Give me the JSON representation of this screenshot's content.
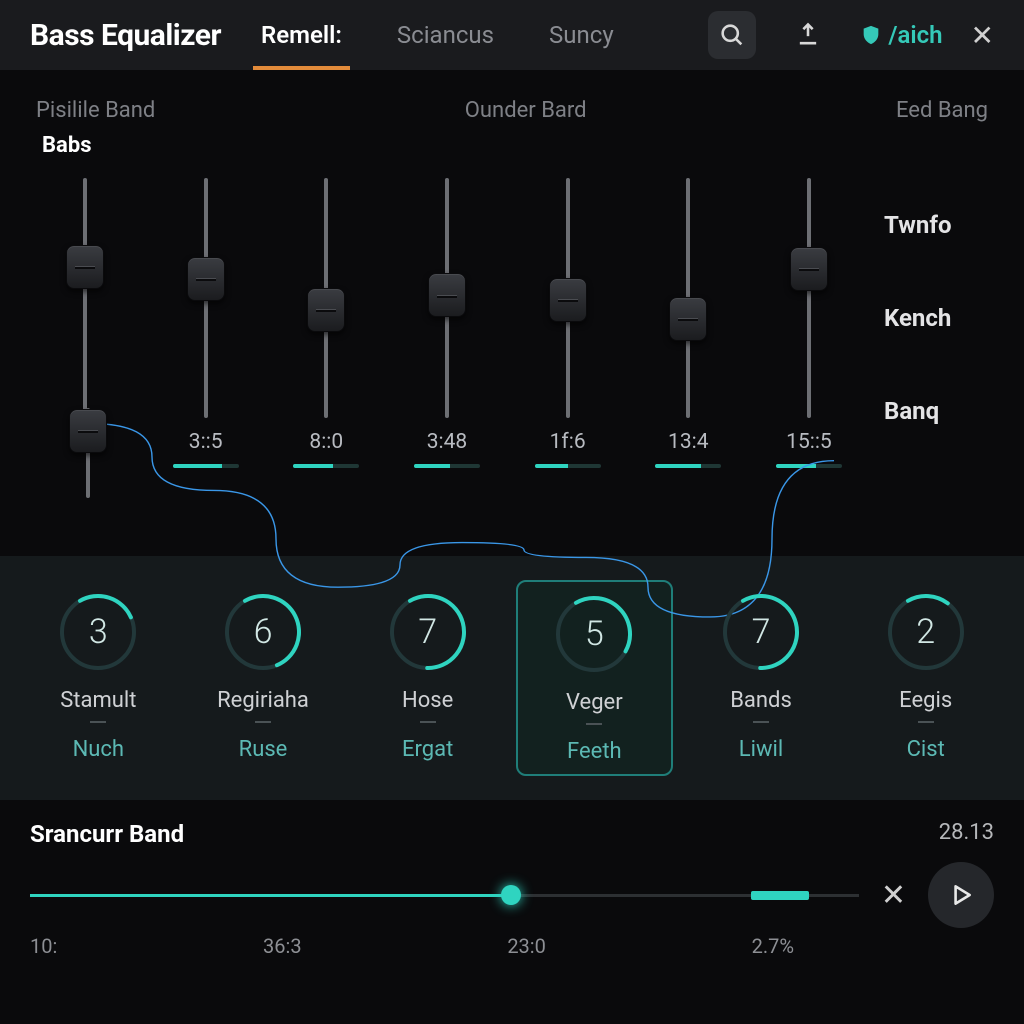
{
  "header": {
    "title": "Bass Equalizer",
    "tabs": [
      {
        "label": "Remell:",
        "active": true
      },
      {
        "label": "Sciancus",
        "active": false
      },
      {
        "label": "Suncy",
        "active": false
      }
    ],
    "aich_label": "/aich"
  },
  "eq": {
    "top_left": "Pisilile Band",
    "top_center": "Ounder Bard",
    "top_right": "Eed Bang",
    "babs": "Babs",
    "sliders": [
      {
        "pos": 33,
        "val_label": "",
        "bar_pct": 0
      },
      {
        "pos": 42,
        "val_label": "3::5",
        "bar_pct": 75
      },
      {
        "pos": 55,
        "val_label": "8::0",
        "bar_pct": 60
      },
      {
        "pos": 49,
        "val_label": "3:48",
        "bar_pct": 55
      },
      {
        "pos": 51,
        "val_label": "1f:6",
        "bar_pct": 50
      },
      {
        "pos": 59,
        "val_label": "13:4",
        "bar_pct": 70
      },
      {
        "pos": 38,
        "val_label": "15::5",
        "bar_pct": 60
      }
    ],
    "right_labels": [
      "Twnfo",
      "Kench",
      "Banq"
    ]
  },
  "presets": [
    {
      "num": "3",
      "name": "Stamult",
      "sub": "Nuch",
      "arc": 40,
      "selected": false
    },
    {
      "num": "6",
      "name": "Regiriaha",
      "sub": "Ruse",
      "arc": 78,
      "selected": false
    },
    {
      "num": "7",
      "name": "Hose",
      "sub": "Ergat",
      "arc": 88,
      "selected": false
    },
    {
      "num": "5",
      "name": "Veger",
      "sub": "Feeth",
      "arc": 62,
      "selected": true
    },
    {
      "num": "7",
      "name": "Bands",
      "sub": "Liwil",
      "arc": 88,
      "selected": false
    },
    {
      "num": "2",
      "name": "Eegis",
      "sub": "Cist",
      "arc": 28,
      "selected": false
    }
  ],
  "transport": {
    "title": "Srancurr Band",
    "total": "28.13",
    "progress_pct": 58,
    "segment_start_pct": 87,
    "segment_width_pct": 7,
    "ticks": [
      "10:",
      "36:3",
      "23:0",
      "2.7%"
    ]
  },
  "chart_data": {
    "type": "line",
    "title": "Equalizer curve",
    "x": [
      0,
      1,
      2,
      3,
      4,
      5,
      6
    ],
    "values": [
      67,
      58,
      45,
      51,
      49,
      41,
      62
    ],
    "ylim": [
      0,
      100
    ],
    "right_axis_labels": [
      "Twnfo",
      "Kench",
      "Banq"
    ]
  }
}
